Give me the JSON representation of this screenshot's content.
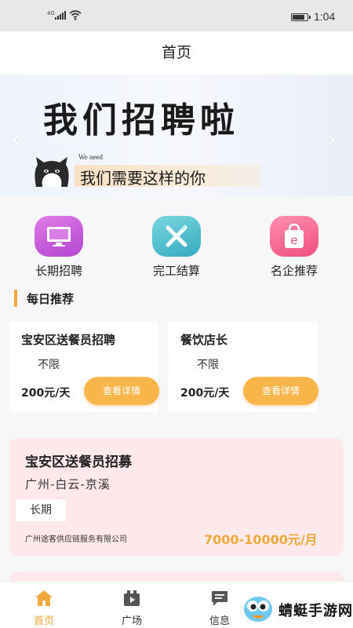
{
  "status_bar": {
    "network": "4G",
    "time": "1:04"
  },
  "header": {
    "title": "首页"
  },
  "banner": {
    "headline": "我们招聘啦",
    "we_need": "We need",
    "subline": "我们需要这样的你",
    "prev_icon": "chevron-left-icon",
    "next_icon": "chevron-right-icon"
  },
  "shortcuts": [
    {
      "label": "长期招聘",
      "icon": "monitor-icon",
      "color": "#c84fd8"
    },
    {
      "label": "完工结算",
      "icon": "tools-icon",
      "color": "#3fb7c7"
    },
    {
      "label": "名企推荐",
      "icon": "shopping-bag-icon",
      "color": "#f25a86"
    }
  ],
  "daily": {
    "title": "每日推荐",
    "cards": [
      {
        "name": "宝安区送餐员招聘",
        "requirement": "不限",
        "salary": "200元/天",
        "button": "查看详情"
      },
      {
        "name": "餐饮店长",
        "requirement": "不限",
        "salary": "200元/天",
        "button": "查看详情"
      }
    ]
  },
  "job": {
    "title": "宝安区送餐员招募",
    "location": "广州-白云-京溪",
    "tag": "长期",
    "company": "广州途客供应链服务有限公司",
    "pay": "7000-10000元/月"
  },
  "tabbar": [
    {
      "label": "首页",
      "icon": "home-icon",
      "active": true
    },
    {
      "label": "广场",
      "icon": "video-icon",
      "active": false
    },
    {
      "label": "信息",
      "icon": "message-icon",
      "active": false
    }
  ],
  "watermark": {
    "text": "蜻蜓手游网"
  },
  "colors": {
    "accent": "#f0a93a",
    "button": "#f7b54a",
    "job_card_bg": "#fde8ec"
  }
}
